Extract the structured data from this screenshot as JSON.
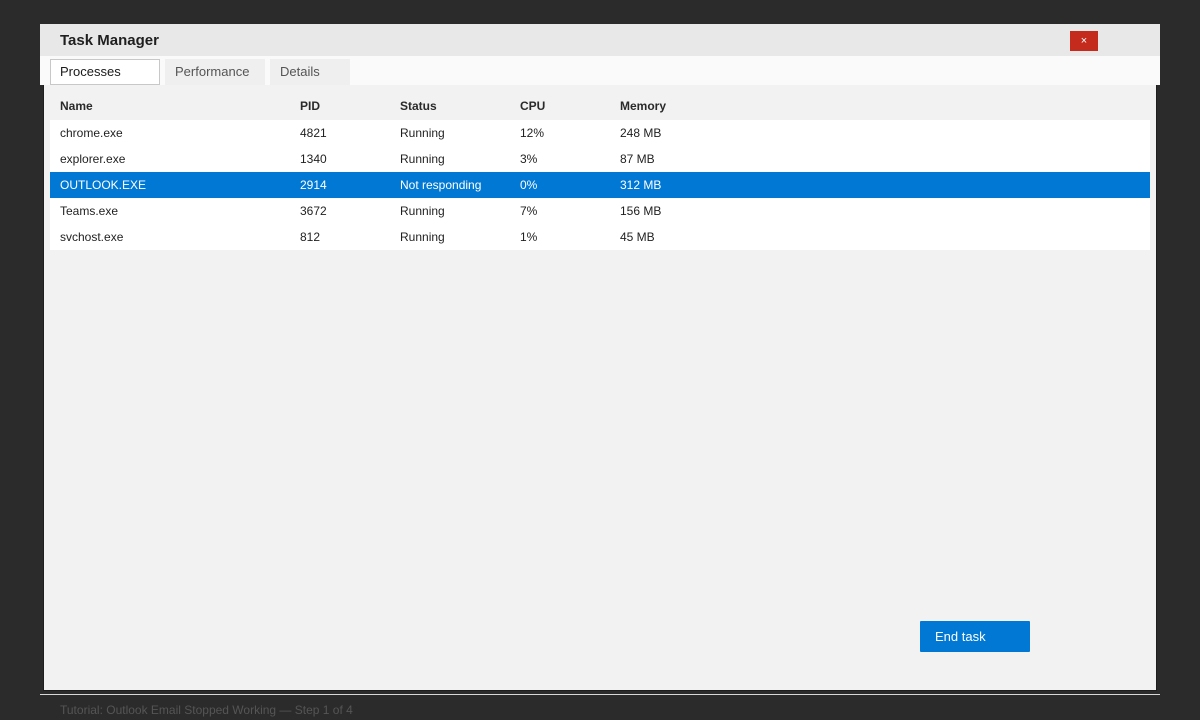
{
  "window": {
    "title": "Task Manager",
    "close_label": "×"
  },
  "tabs": [
    {
      "label": "Processes",
      "active": true
    },
    {
      "label": "Performance",
      "active": false
    },
    {
      "label": "Details",
      "active": false
    }
  ],
  "table": {
    "columns": [
      "Name",
      "PID",
      "Status",
      "CPU",
      "Memory"
    ],
    "rows": [
      {
        "name": "chrome.exe",
        "pid": "4821",
        "status": "Running",
        "cpu": "12%",
        "memory": "248 MB",
        "selected": false
      },
      {
        "name": "explorer.exe",
        "pid": "1340",
        "status": "Running",
        "cpu": "3%",
        "memory": "87 MB",
        "selected": false
      },
      {
        "name": "OUTLOOK.EXE",
        "pid": "2914",
        "status": "Not responding",
        "cpu": "0%",
        "memory": "312 MB",
        "selected": true
      },
      {
        "name": "Teams.exe",
        "pid": "3672",
        "status": "Running",
        "cpu": "7%",
        "memory": "156 MB",
        "selected": false
      },
      {
        "name": "svchost.exe",
        "pid": "812",
        "status": "Running",
        "cpu": "1%",
        "memory": "45 MB",
        "selected": false
      }
    ]
  },
  "actions": {
    "end_task_label": "End task"
  },
  "footer": {
    "caption": "Tutorial: Outlook Email Stopped Working — Step 1 of 4"
  },
  "colors": {
    "accent": "#0078d4",
    "close": "#c42b1c",
    "window_bg": "#f2f2f2",
    "desktop_bg": "#2b2b2b"
  }
}
